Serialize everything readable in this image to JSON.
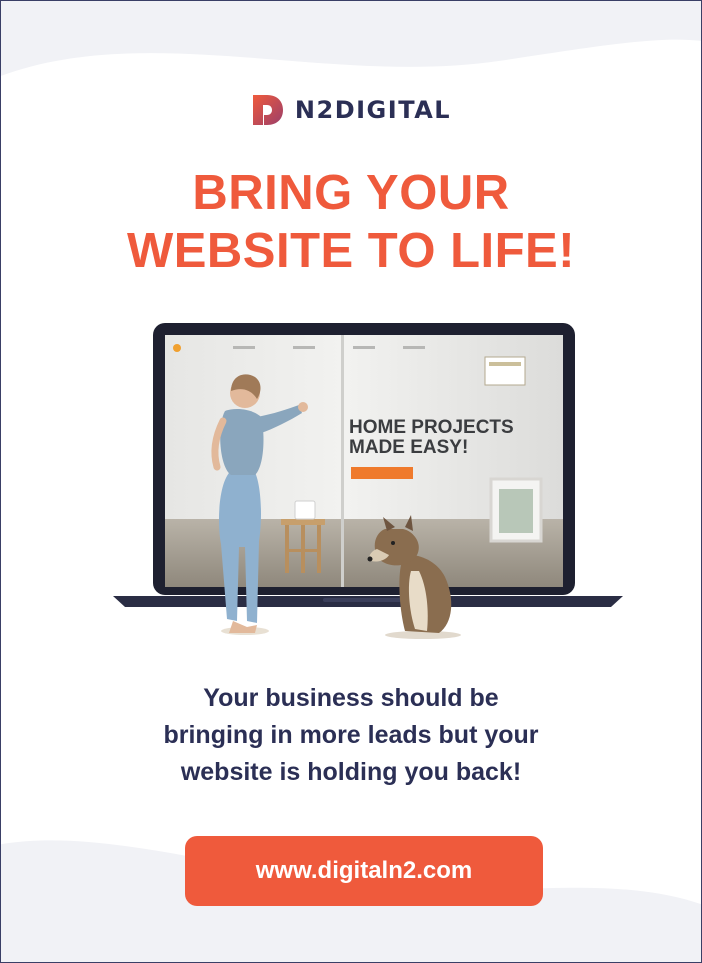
{
  "brand": {
    "name": "N2DIGITAL"
  },
  "headline": {
    "line1": "BRING YOUR",
    "line2": "WEBSITE TO LIFE!"
  },
  "screen": {
    "hero_line1": "HOME PROJECTS",
    "hero_line2": "MADE EASY!"
  },
  "body": {
    "line1": "Your business should be",
    "line2": "bringing in more leads but your",
    "line3": "website is holding you back!"
  },
  "cta": {
    "label": "www.digitaln2.com"
  },
  "colors": {
    "accent": "#ef5a3c",
    "navy": "#2b2f55",
    "background": "#f1f2f6"
  }
}
